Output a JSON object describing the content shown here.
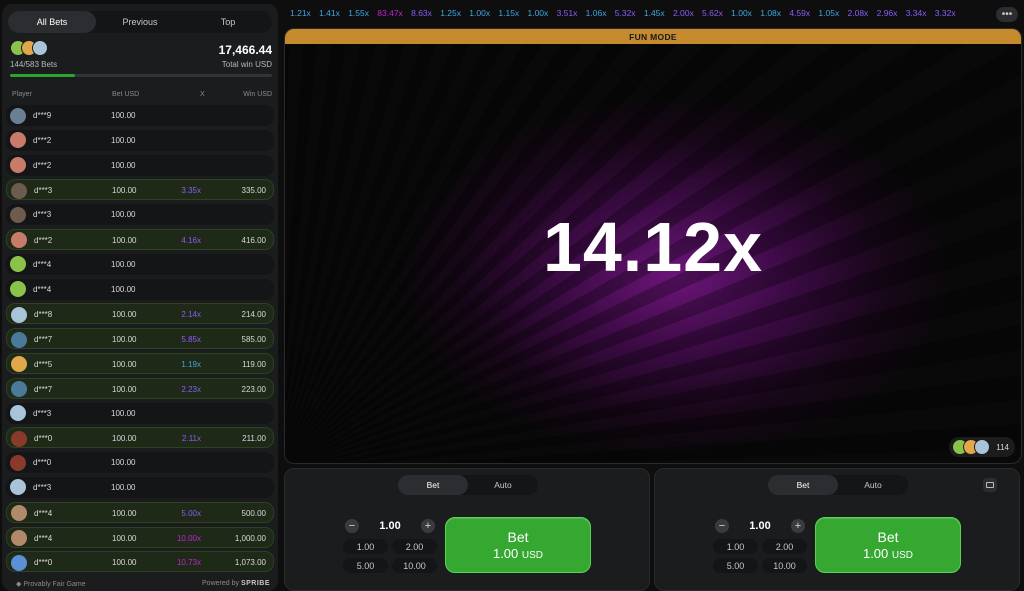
{
  "left_panel": {
    "tabs": [
      {
        "label": "All Bets",
        "active": true
      },
      {
        "label": "Previous",
        "active": false
      },
      {
        "label": "Top",
        "active": false
      }
    ],
    "summary": {
      "bets_count": "144/583 Bets",
      "total_win": "17,466.44",
      "total_win_label": "Total win USD",
      "progress_fraction": 0.247
    },
    "columns": {
      "player": "Player",
      "bet": "Bet USD",
      "mult": "X",
      "win": "Win USD"
    },
    "rows": [
      {
        "player": "d***9",
        "bet": "100.00",
        "mult": "",
        "win": "",
        "avatar": "#6a7f95",
        "mult_color": ""
      },
      {
        "player": "d***2",
        "bet": "100.00",
        "mult": "",
        "win": "",
        "avatar": "#c97b6a",
        "mult_color": ""
      },
      {
        "player": "d***2",
        "bet": "100.00",
        "mult": "",
        "win": "",
        "avatar": "#c97b6a",
        "mult_color": ""
      },
      {
        "player": "d***3",
        "bet": "100.00",
        "mult": "3.35x",
        "win": "335.00",
        "avatar": "#6d5b4e",
        "mult_color": "#8b5cf6"
      },
      {
        "player": "d***3",
        "bet": "100.00",
        "mult": "",
        "win": "",
        "avatar": "#6d5b4e",
        "mult_color": ""
      },
      {
        "player": "d***2",
        "bet": "100.00",
        "mult": "4.16x",
        "win": "416.00",
        "avatar": "#c97b6a",
        "mult_color": "#8b5cf6"
      },
      {
        "player": "d***4",
        "bet": "100.00",
        "mult": "",
        "win": "",
        "avatar": "#8bc34a",
        "mult_color": ""
      },
      {
        "player": "d***4",
        "bet": "100.00",
        "mult": "",
        "win": "",
        "avatar": "#8bc34a",
        "mult_color": ""
      },
      {
        "player": "d***8",
        "bet": "100.00",
        "mult": "2.14x",
        "win": "214.00",
        "avatar": "#a9c4d8",
        "mult_color": "#8b5cf6"
      },
      {
        "player": "d***7",
        "bet": "100.00",
        "mult": "5.85x",
        "win": "585.00",
        "avatar": "#4a7a9a",
        "mult_color": "#8b5cf6"
      },
      {
        "player": "d***5",
        "bet": "100.00",
        "mult": "1.19x",
        "win": "119.00",
        "avatar": "#e0a84a",
        "mult_color": "#3fa8e0"
      },
      {
        "player": "d***7",
        "bet": "100.00",
        "mult": "2.23x",
        "win": "223.00",
        "avatar": "#4a7a9a",
        "mult_color": "#8b5cf6"
      },
      {
        "player": "d***3",
        "bet": "100.00",
        "mult": "",
        "win": "",
        "avatar": "#a9c4d8",
        "mult_color": ""
      },
      {
        "player": "d***0",
        "bet": "100.00",
        "mult": "2.11x",
        "win": "211.00",
        "avatar": "#8a3a2a",
        "mult_color": "#8b5cf6"
      },
      {
        "player": "d***0",
        "bet": "100.00",
        "mult": "",
        "win": "",
        "avatar": "#8a3a2a",
        "mult_color": ""
      },
      {
        "player": "d***3",
        "bet": "100.00",
        "mult": "",
        "win": "",
        "avatar": "#a9c4d8",
        "mult_color": ""
      },
      {
        "player": "d***4",
        "bet": "100.00",
        "mult": "5.00x",
        "win": "500.00",
        "avatar": "#b08a6a",
        "mult_color": "#8b5cf6"
      },
      {
        "player": "d***4",
        "bet": "100.00",
        "mult": "10.00x",
        "win": "1,000.00",
        "avatar": "#b08a6a",
        "mult_color": "#c026d3"
      },
      {
        "player": "d***0",
        "bet": "100.00",
        "mult": "10.73x",
        "win": "1,073.00",
        "avatar": "#5b8fd6",
        "mult_color": "#c026d3"
      }
    ],
    "footer": {
      "fair": "Provably Fair Game",
      "powered": "Powered by",
      "brand": "SPRIBE"
    }
  },
  "history": [
    {
      "v": "1.21x",
      "c": "#3fa8e0"
    },
    {
      "v": "1.41x",
      "c": "#3fa8e0"
    },
    {
      "v": "1.55x",
      "c": "#3fa8e0"
    },
    {
      "v": "83.47x",
      "c": "#c026d3"
    },
    {
      "v": "8.63x",
      "c": "#8b5cf6"
    },
    {
      "v": "1.25x",
      "c": "#3fa8e0"
    },
    {
      "v": "1.00x",
      "c": "#3fa8e0"
    },
    {
      "v": "1.15x",
      "c": "#3fa8e0"
    },
    {
      "v": "1.00x",
      "c": "#3fa8e0"
    },
    {
      "v": "3.51x",
      "c": "#8b5cf6"
    },
    {
      "v": "1.06x",
      "c": "#3fa8e0"
    },
    {
      "v": "5.32x",
      "c": "#8b5cf6"
    },
    {
      "v": "1.45x",
      "c": "#3fa8e0"
    },
    {
      "v": "2.00x",
      "c": "#8b5cf6"
    },
    {
      "v": "5.62x",
      "c": "#8b5cf6"
    },
    {
      "v": "1.00x",
      "c": "#3fa8e0"
    },
    {
      "v": "1.08x",
      "c": "#3fa8e0"
    },
    {
      "v": "4.59x",
      "c": "#8b5cf6"
    },
    {
      "v": "1.05x",
      "c": "#3fa8e0"
    },
    {
      "v": "2.08x",
      "c": "#8b5cf6"
    },
    {
      "v": "2.96x",
      "c": "#8b5cf6"
    },
    {
      "v": "3.34x",
      "c": "#8b5cf6"
    },
    {
      "v": "3.32x",
      "c": "#8b5cf6"
    }
  ],
  "game": {
    "banner": "FUN MODE",
    "multiplier": "14.12x",
    "players_online": "114"
  },
  "bet_panels": [
    {
      "tabs": [
        "Bet",
        "Auto"
      ],
      "stake": "1.00",
      "quick": [
        "1.00",
        "2.00",
        "5.00",
        "10.00"
      ],
      "button_label": "Bet",
      "button_amount": "1.00",
      "currency": "USD"
    },
    {
      "tabs": [
        "Bet",
        "Auto"
      ],
      "stake": "1.00",
      "quick": [
        "1.00",
        "2.00",
        "5.00",
        "10.00"
      ],
      "button_label": "Bet",
      "button_amount": "1.00",
      "currency": "USD"
    }
  ],
  "colors": {
    "accent_green": "#35a831",
    "fun_mode_banner": "#c48a2d",
    "glow_purple": "#6b1578"
  }
}
